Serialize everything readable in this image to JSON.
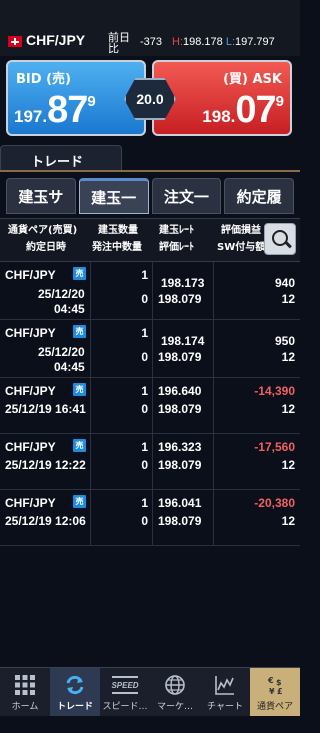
{
  "header": {
    "pair": "CHF/JPY",
    "prev_label": "前日 比",
    "change": "-373",
    "high_label": "H:",
    "high": "198.178",
    "low_label": "L:",
    "low": "197.797"
  },
  "quotes": {
    "bid_label": "BID (売)",
    "bid_price": {
      "lead": "197.",
      "main": "87",
      "sup": "9"
    },
    "ask_label": "(買) ASK",
    "ask_price": {
      "lead": "198.",
      "main": "07",
      "sup": "9"
    },
    "spread": "20.0"
  },
  "section_title": "トレード",
  "tabs": [
    {
      "label": "建玉サ",
      "active": false
    },
    {
      "label": "建玉一",
      "active": true
    },
    {
      "label": "注文一",
      "active": false
    },
    {
      "label": "約定履",
      "active": false
    }
  ],
  "table_header": {
    "col1_line1": "通貨ペア(売買)",
    "col1_line2": "約定日時",
    "col2_line1": "建玉数量",
    "col2_line2": "発注中数量",
    "col3_line1": "建玉ﾚｰﾄ",
    "col3_line2": "評価ﾚｰﾄ",
    "col4_line1": "評価損益",
    "col4_line2": "SW付与額"
  },
  "rows": [
    {
      "pair": "CHF/JPY",
      "side": "売",
      "date": "25/12/20",
      "time": "04:45",
      "qty": "1",
      "pending": "0",
      "rate": "198.173",
      "eval_rate": "198.079",
      "pnl": "940",
      "swap": "12"
    },
    {
      "pair": "CHF/JPY",
      "side": "売",
      "date": "25/12/20",
      "time": "04:45",
      "qty": "1",
      "pending": "0",
      "rate": "198.174",
      "eval_rate": "198.079",
      "pnl": "950",
      "swap": "12"
    },
    {
      "pair": "CHF/JPY",
      "side": "売",
      "datetime": "25/12/19 16:41",
      "qty": "1",
      "pending": "0",
      "rate": "196.640",
      "eval_rate": "198.079",
      "pnl": "-14,390",
      "swap": "12"
    },
    {
      "pair": "CHF/JPY",
      "side": "売",
      "datetime": "25/12/19 12:22",
      "qty": "1",
      "pending": "0",
      "rate": "196.323",
      "eval_rate": "198.079",
      "pnl": "-17,560",
      "swap": "12"
    },
    {
      "pair": "CHF/JPY",
      "side": "売",
      "datetime": "25/12/19 12:06",
      "qty": "1",
      "pending": "0",
      "rate": "196.041",
      "eval_rate": "198.079",
      "pnl": "-20,380",
      "swap": "12"
    }
  ],
  "nav": [
    {
      "label": "ホーム",
      "icon": "grid-icon"
    },
    {
      "label": "トレード",
      "icon": "refresh-icon"
    },
    {
      "label": "スピード…",
      "icon": "speed-icon"
    },
    {
      "label": "マーケ…",
      "icon": "globe-icon"
    },
    {
      "label": "チャート",
      "icon": "chart-icon"
    },
    {
      "label": "通貨ペア",
      "icon": "currency-icon"
    }
  ],
  "nav_speed_text": "SPEED",
  "colors": {
    "bid": "#1a78d0",
    "ask": "#c71f24",
    "negative": "#f06060",
    "badge": "#1d8ce0"
  }
}
